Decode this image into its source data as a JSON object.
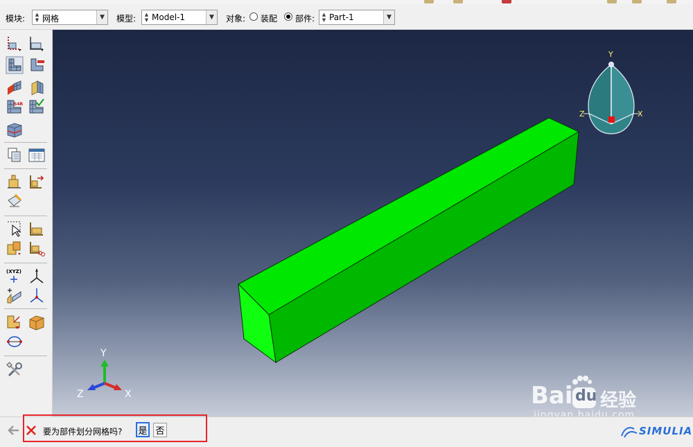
{
  "context_bar": {
    "module_label": "模块:",
    "module_value": "网格",
    "model_label": "模型:",
    "model_value": "Model-1",
    "object_label": "对象:",
    "assembly_option": "装配",
    "part_option": "部件:",
    "selected_object": "part",
    "part_value": "Part-1"
  },
  "viewport": {
    "triad_labels": {
      "y": "Y",
      "z": "Z",
      "x": "X"
    },
    "view_cube_labels": {
      "y": "Y",
      "z": "Z",
      "x": "X"
    },
    "part_color": "#00ee00",
    "background_top": "#1c2744",
    "background_bottom": "#c6ccd8"
  },
  "prompt": {
    "question": "要为部件划分网格吗?",
    "yes_button": "是",
    "no_button": "否"
  },
  "watermark": {
    "brand_bai": "Bai",
    "brand_du": "du",
    "brand_suffix": "经验",
    "url": "jingyan.baidu.com",
    "vendor": "SIMULIA"
  },
  "highlight_color": "#e8232a"
}
